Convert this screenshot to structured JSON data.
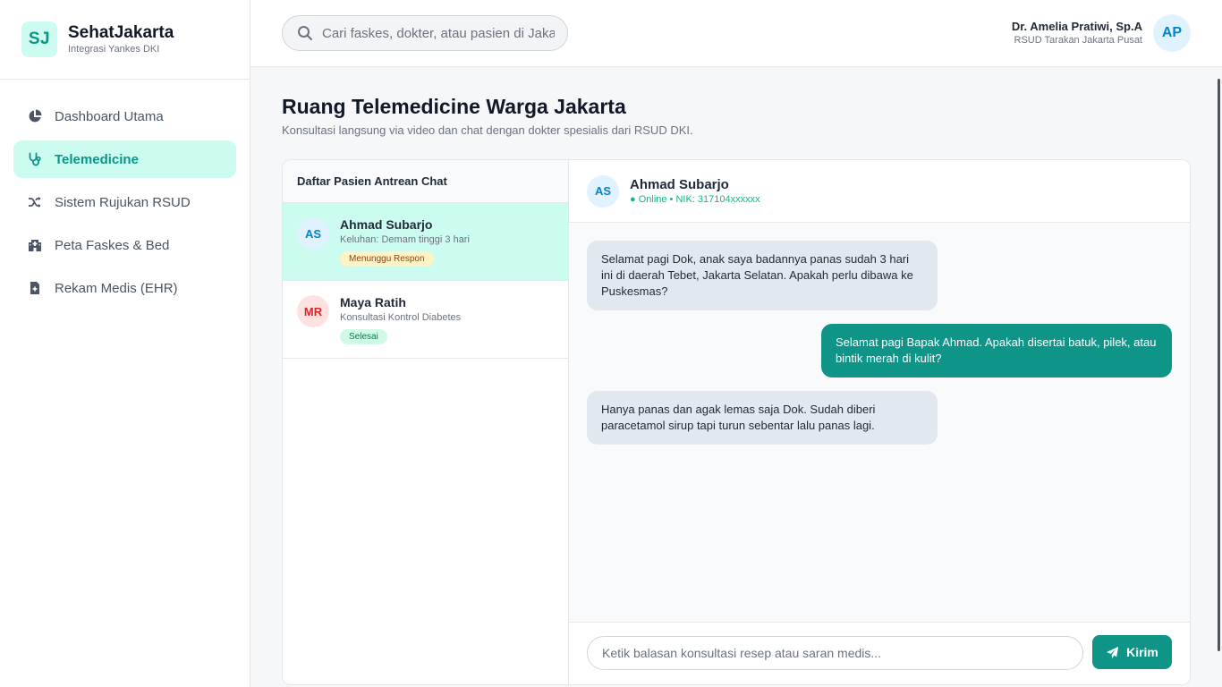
{
  "brand": {
    "logo": "SJ",
    "name": "SehatJakarta",
    "subtitle": "Integrasi Yankes DKI"
  },
  "nav": [
    {
      "label": "Dashboard Utama",
      "icon": "pie-chart-icon",
      "active": false
    },
    {
      "label": "Telemedicine",
      "icon": "stethoscope-icon",
      "active": true
    },
    {
      "label": "Sistem Rujukan RSUD",
      "icon": "shuffle-icon",
      "active": false
    },
    {
      "label": "Peta Faskes & Bed",
      "icon": "hospital-icon",
      "active": false
    },
    {
      "label": "Rekam Medis (EHR)",
      "icon": "medical-file-icon",
      "active": false
    }
  ],
  "search": {
    "placeholder": "Cari faskes, dokter, atau pasien di Jakarta..."
  },
  "user": {
    "name": "Dr. Amelia Pratiwi, Sp.A",
    "hospital": "RSUD Tarakan Jakarta Pusat",
    "initials": "AP"
  },
  "page": {
    "title": "Ruang Telemedicine Warga Jakarta",
    "subtitle": "Konsultasi langsung via video dan chat dengan dokter spesialis dari RSUD DKI."
  },
  "queue": {
    "title": "Daftar Pasien Antrean Chat",
    "patients": [
      {
        "initials": "AS",
        "name": "Ahmad Subarjo",
        "complaint": "Keluhan: Demam tinggi 3 hari",
        "status": "Menunggu Respon"
      },
      {
        "initials": "MR",
        "name": "Maya Ratih",
        "complaint": "Konsultasi Kontrol Diabetes",
        "status": "Selesai"
      }
    ]
  },
  "chat": {
    "initials": "AS",
    "name": "Ahmad Subarjo",
    "status": "● Online • NIK: 317104xxxxxx",
    "messages": [
      {
        "from": "patient",
        "text": "Selamat pagi Dok, anak saya badannya panas sudah 3 hari ini di daerah Tebet, Jakarta Selatan. Apakah perlu dibawa ke Puskesmas?"
      },
      {
        "from": "doctor",
        "text": "Selamat pagi Bapak Ahmad. Apakah disertai batuk, pilek, atau bintik merah di kulit?"
      },
      {
        "from": "patient",
        "text": "Hanya panas dan agak lemas saja Dok. Sudah diberi paracetamol sirup tapi turun sebentar lalu panas lagi."
      }
    ],
    "input_placeholder": "Ketik balasan konsultasi resep atau saran medis...",
    "send_label": "Kirim"
  },
  "colors": {
    "primary": "#0f9488",
    "primary_light": "#ccfbef"
  }
}
